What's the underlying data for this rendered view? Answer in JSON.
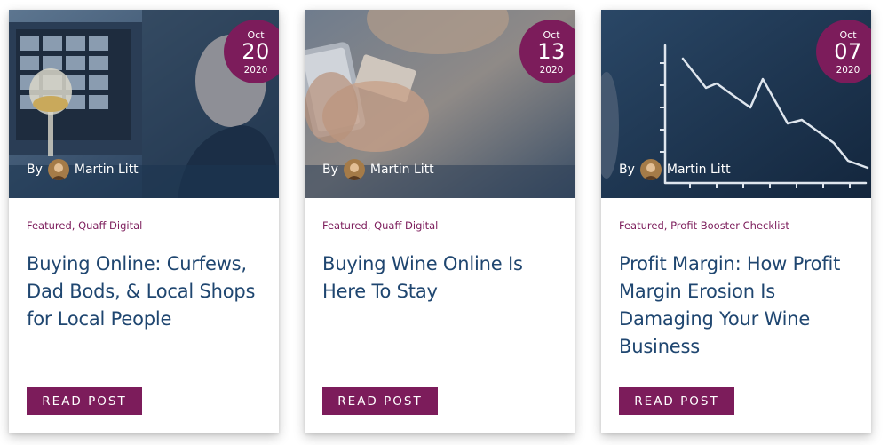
{
  "posts": [
    {
      "date": {
        "month": "Oct",
        "day": "20",
        "year": "2020"
      },
      "byline": {
        "by": "By",
        "author": "Martin Litt"
      },
      "categories": [
        "Featured",
        "Quaff Digital"
      ],
      "title": "Buying Online: Curfews, Dad Bods, & Local Shops for Local People",
      "button": "READ POST"
    },
    {
      "date": {
        "month": "Oct",
        "day": "13",
        "year": "2020"
      },
      "byline": {
        "by": "By",
        "author": "Martin Litt"
      },
      "categories": [
        "Featured",
        "Quaff Digital"
      ],
      "title": "Buying Wine Online Is Here To Stay",
      "button": "READ POST"
    },
    {
      "date": {
        "month": "Oct",
        "day": "07",
        "year": "2020"
      },
      "byline": {
        "by": "By",
        "author": "Martin Litt"
      },
      "categories": [
        "Featured",
        "Profit Booster Checklist"
      ],
      "title": "Profit Margin: How Profit Margin Erosion Is Damaging Your Wine Business",
      "button": "READ POST"
    }
  ],
  "separator": ",",
  "colors": {
    "accent": "#7c1c5b",
    "title": "#1f4670",
    "overlay": "#1d3a5c"
  }
}
